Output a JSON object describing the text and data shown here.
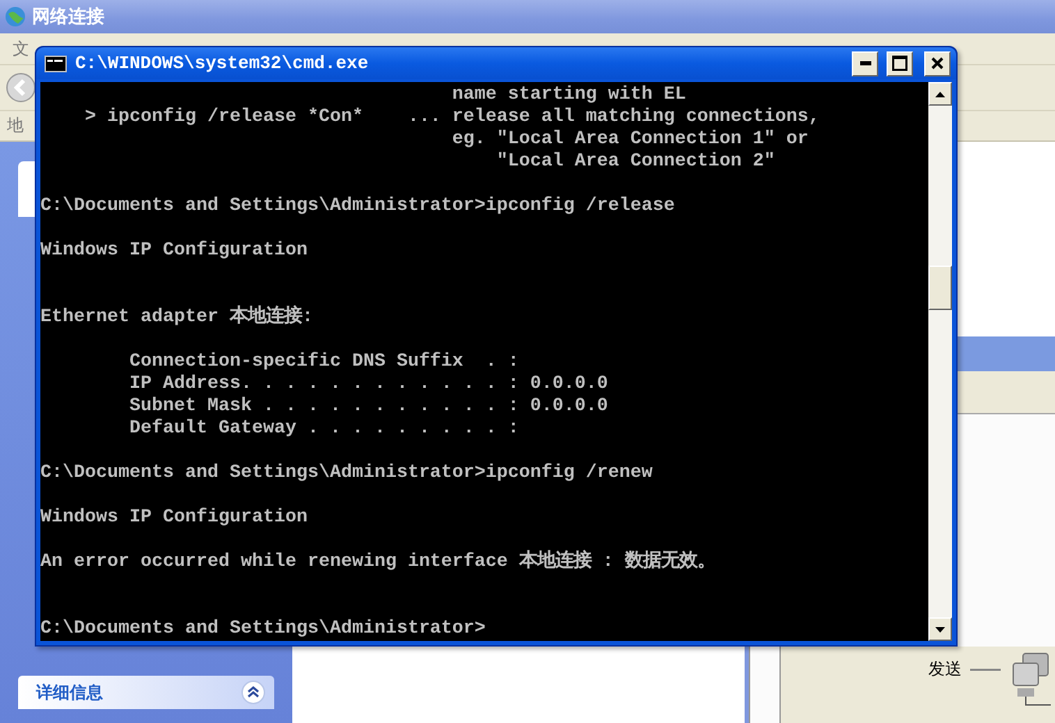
{
  "explorer": {
    "title": "网络连接",
    "menu": [
      "文"
    ],
    "address_label": "地",
    "task_pane": {
      "details_header": "详细信息"
    },
    "status_dialog": {
      "send_label": "发送"
    }
  },
  "console": {
    "title": "C:\\WINDOWS\\system32\\cmd.exe",
    "lines": [
      {
        "kind": "text",
        "text": "                                     name starting with EL"
      },
      {
        "kind": "text",
        "text": "    > ipconfig /release *Con*    ... release all matching connections,"
      },
      {
        "kind": "text",
        "text": "                                     eg. \"Local Area Connection 1\" or"
      },
      {
        "kind": "text",
        "text": "                                         \"Local Area Connection 2\""
      },
      {
        "kind": "blank"
      },
      {
        "kind": "text",
        "text": "C:\\Documents and Settings\\Administrator>ipconfig /release"
      },
      {
        "kind": "blank"
      },
      {
        "kind": "text",
        "text": "Windows IP Configuration"
      },
      {
        "kind": "blank"
      },
      {
        "kind": "blank"
      },
      {
        "kind": "text",
        "text": "Ethernet adapter 本地连接:"
      },
      {
        "kind": "blank"
      },
      {
        "kind": "text",
        "text": "        Connection-specific DNS Suffix  . :"
      },
      {
        "kind": "text",
        "text": "        IP Address. . . . . . . . . . . . : 0.0.0.0"
      },
      {
        "kind": "text",
        "text": "        Subnet Mask . . . . . . . . . . . : 0.0.0.0"
      },
      {
        "kind": "text",
        "text": "        Default Gateway . . . . . . . . . :"
      },
      {
        "kind": "blank"
      },
      {
        "kind": "text",
        "text": "C:\\Documents and Settings\\Administrator>ipconfig /renew"
      },
      {
        "kind": "blank"
      },
      {
        "kind": "text",
        "text": "Windows IP Configuration"
      },
      {
        "kind": "blank"
      },
      {
        "kind": "text",
        "text": "An error occurred while renewing interface 本地连接 : 数据无效。"
      },
      {
        "kind": "blank"
      },
      {
        "kind": "blank"
      },
      {
        "kind": "text",
        "text": "C:\\Documents and Settings\\Administrator>"
      }
    ]
  }
}
